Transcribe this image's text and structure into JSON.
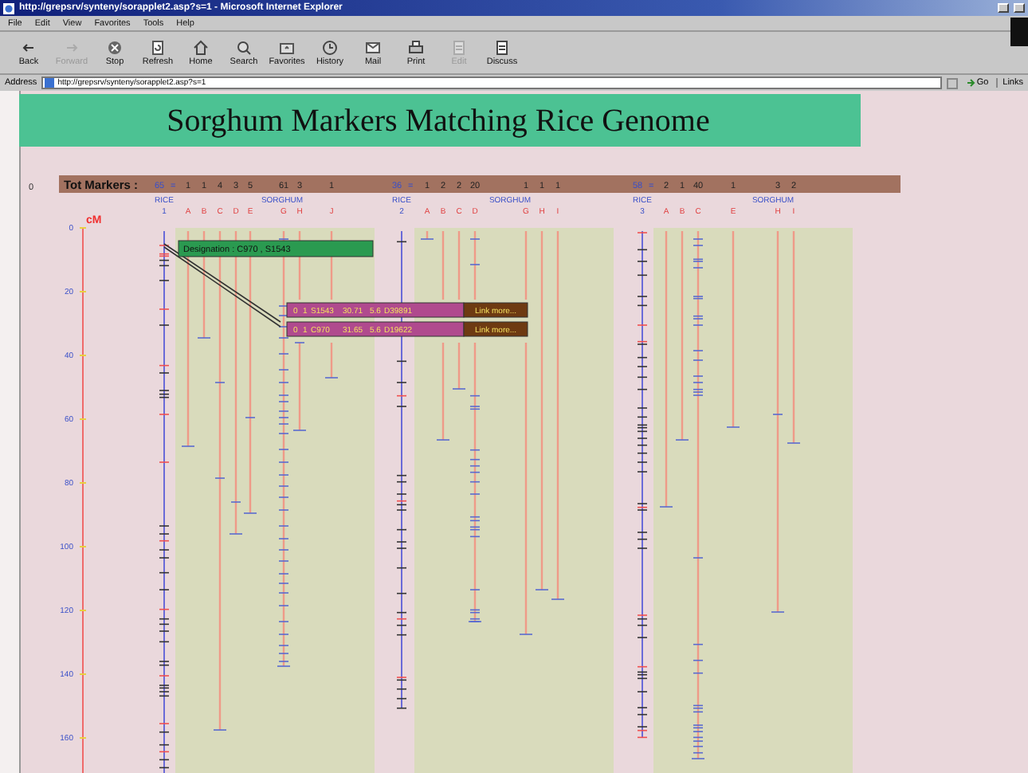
{
  "window": {
    "title": "http://grepsrv/synteny/sorapplet2.asp?s=1 - Microsoft Internet Explorer"
  },
  "menu": [
    "File",
    "Edit",
    "View",
    "Favorites",
    "Tools",
    "Help"
  ],
  "toolbar": [
    {
      "label": "Back",
      "disabled": false
    },
    {
      "label": "Forward",
      "disabled": true
    },
    {
      "label": "Stop",
      "disabled": false
    },
    {
      "label": "Refresh",
      "disabled": false
    },
    {
      "label": "Home",
      "disabled": false
    },
    {
      "label": "Search",
      "disabled": false
    },
    {
      "label": "Favorites",
      "disabled": false
    },
    {
      "label": "History",
      "disabled": false
    },
    {
      "label": "Mail",
      "disabled": false
    },
    {
      "label": "Print",
      "disabled": false
    },
    {
      "label": "Edit",
      "disabled": true
    },
    {
      "label": "Discuss",
      "disabled": false
    }
  ],
  "address": {
    "label": "Address",
    "url": "http://grepsrv/synteny/sorapplet2.asp?s=1",
    "go": "Go",
    "links": "Links"
  },
  "page": {
    "heading": "Sorghum Markers Matching Rice Genome",
    "row_label": "0",
    "totals_label": "Tot Markers :",
    "axis": {
      "unit": "cM",
      "ticks": [
        "0",
        "20",
        "40",
        "60",
        "80",
        "100",
        "120",
        "140",
        "160"
      ]
    },
    "groups": [
      {
        "total": "65",
        "equals": "=",
        "rice_label": "RICE",
        "rice_number": "1",
        "sorghum_label": "SORGHUM",
        "columns": [
          {
            "letter": "A",
            "count": "1"
          },
          {
            "letter": "B",
            "count": "1"
          },
          {
            "letter": "C",
            "count": "4"
          },
          {
            "letter": "D",
            "count": "3"
          },
          {
            "letter": "E",
            "count": "5"
          },
          {
            "letter": "G",
            "count": "61"
          },
          {
            "letter": "H",
            "count": "3"
          },
          {
            "letter": "J",
            "count": "1"
          }
        ]
      },
      {
        "total": "36",
        "equals": "=",
        "rice_label": "RICE",
        "rice_number": "2",
        "sorghum_label": "SORGHUM",
        "columns": [
          {
            "letter": "A",
            "count": "1"
          },
          {
            "letter": "B",
            "count": "2"
          },
          {
            "letter": "C",
            "count": "2"
          },
          {
            "letter": "D",
            "count": "20"
          },
          {
            "letter": "G",
            "count": "1"
          },
          {
            "letter": "H",
            "count": "1"
          },
          {
            "letter": "I",
            "count": "1"
          }
        ]
      },
      {
        "total": "58",
        "equals": "=",
        "rice_label": "RICE",
        "rice_number": "3",
        "sorghum_label": "SORGHUM",
        "columns": [
          {
            "letter": "A",
            "count": "2"
          },
          {
            "letter": "B",
            "count": "1"
          },
          {
            "letter": "C",
            "count": "40"
          },
          {
            "letter": "E",
            "count": "1"
          },
          {
            "letter": "H",
            "count": "3"
          },
          {
            "letter": "I",
            "count": "2"
          }
        ]
      }
    ],
    "designation": "Designation : C970 , S1543",
    "info_rows": [
      {
        "fields": [
          "0",
          "1",
          "S1543",
          "30.71",
          "5.6",
          "D39891"
        ],
        "link": "Link more..."
      },
      {
        "fields": [
          "0",
          "1",
          "C970",
          "31.65",
          "5.6",
          "D19622"
        ],
        "link": "Link more..."
      }
    ]
  }
}
